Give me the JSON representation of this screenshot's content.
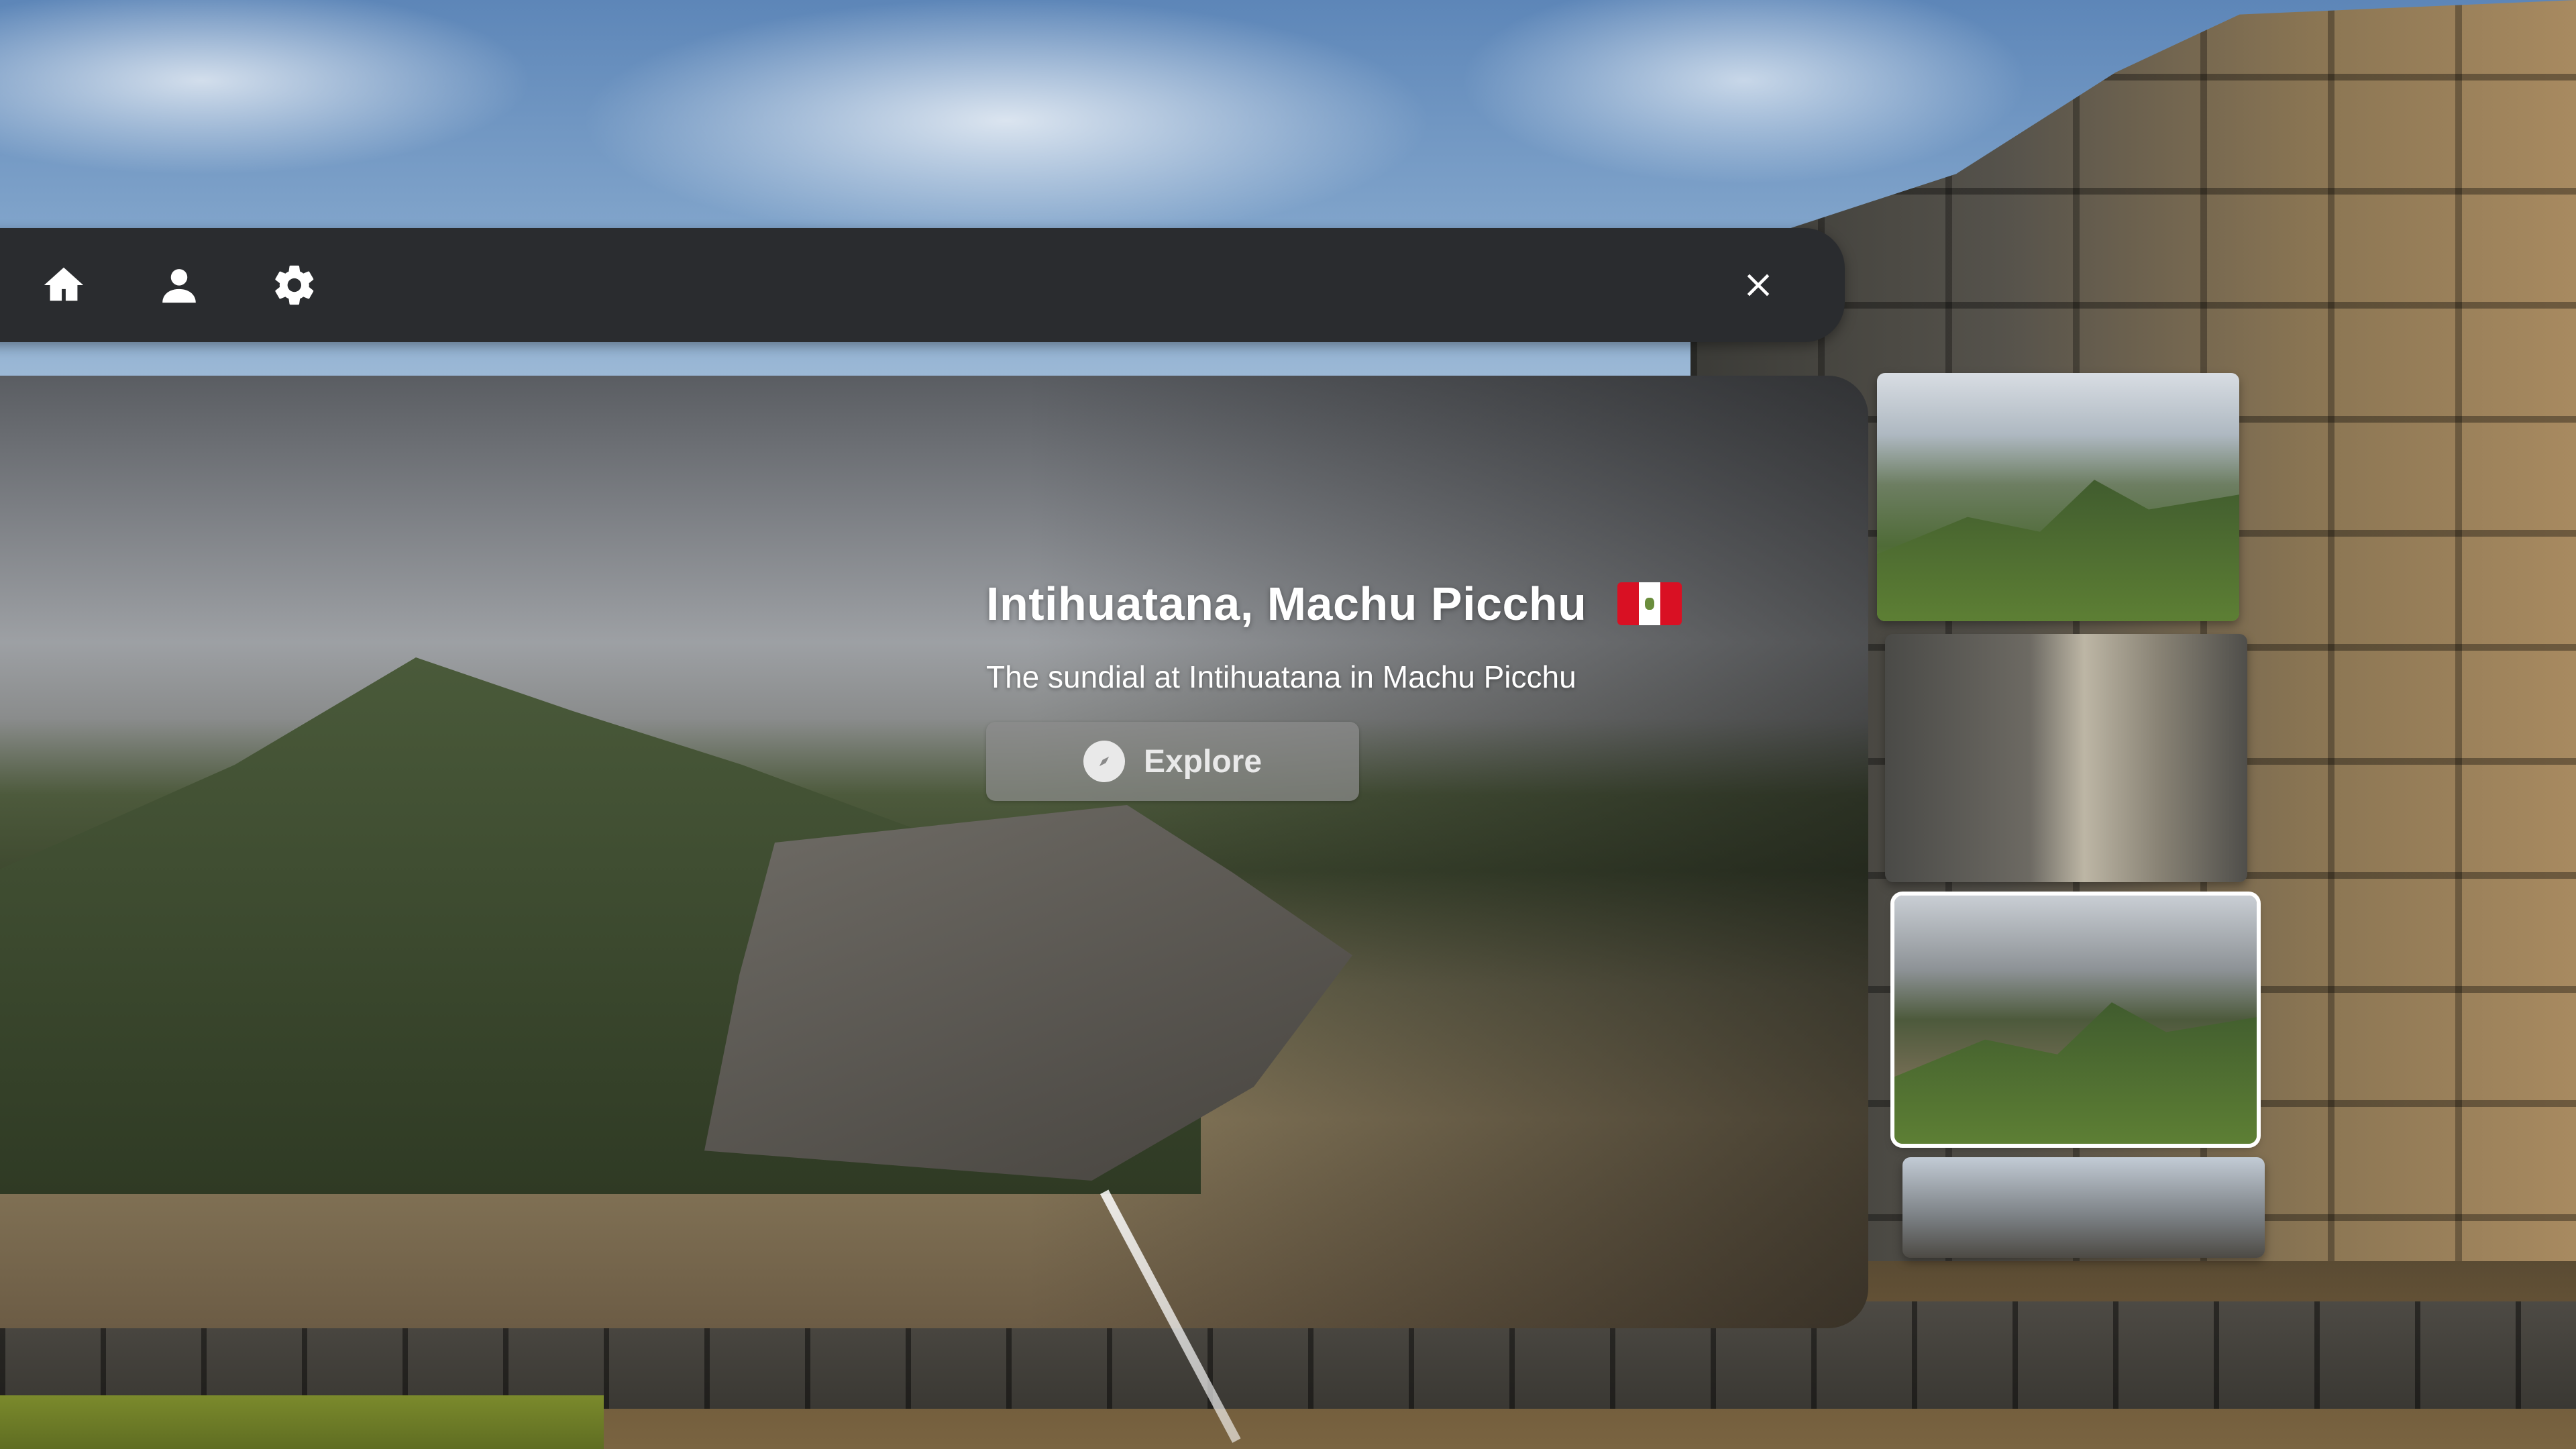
{
  "toolbar": {
    "icons": [
      "home-icon",
      "person-icon",
      "gear-icon",
      "close-icon"
    ]
  },
  "hero": {
    "title": "Intihuatana, Machu Picchu",
    "subtitle": "The sundial at Intihuatana in Machu Picchu",
    "flag": "peru-flag",
    "explore_label": "Explore",
    "explore_icon": "compass-icon"
  },
  "thumbnails": [
    {
      "subject": "machu-picchu-overview",
      "selected": false
    },
    {
      "subject": "stone-steps",
      "selected": false
    },
    {
      "subject": "intihuatana-sundial",
      "selected": true
    },
    {
      "subject": "ruins-and-peaks",
      "selected": false
    }
  ],
  "colors": {
    "toolbar_bg": "#2a2c2f",
    "flag_red": "#d91023",
    "button_bg": "#8c8c8c"
  }
}
